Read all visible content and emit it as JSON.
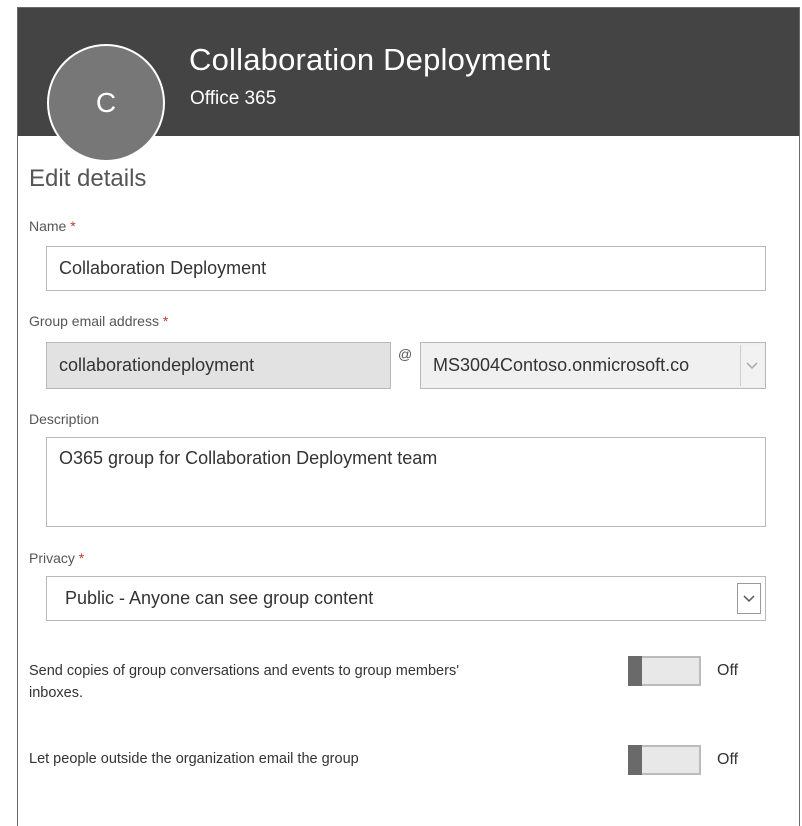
{
  "header": {
    "avatar_letter": "C",
    "title": "Collaboration Deployment",
    "subtitle": "Office 365"
  },
  "form": {
    "section_title": "Edit details",
    "name": {
      "label": "Name",
      "required_mark": "*",
      "value": "Collaboration Deployment"
    },
    "email": {
      "label": "Group email address",
      "required_mark": "*",
      "alias_value": "collaborationdeployment",
      "at_symbol": "@",
      "domain_value": "MS3004Contoso.onmicrosoft.co"
    },
    "description": {
      "label": "Description",
      "value": "O365 group for Collaboration Deployment team"
    },
    "privacy": {
      "label": "Privacy",
      "required_mark": "*",
      "selected": "Public - Anyone can see group content"
    },
    "toggles": [
      {
        "label": "Send copies of group conversations and events to group members' inboxes.",
        "state": "Off"
      },
      {
        "label": "Let people outside the organization email the group",
        "state": "Off"
      }
    ]
  },
  "colors": {
    "header_bg": "#444444",
    "avatar_bg": "#777777",
    "required": "#c0392b",
    "disabled_input_bg": "#e2e2e2"
  },
  "icons": {
    "dropdown": "chevron-down-icon"
  }
}
